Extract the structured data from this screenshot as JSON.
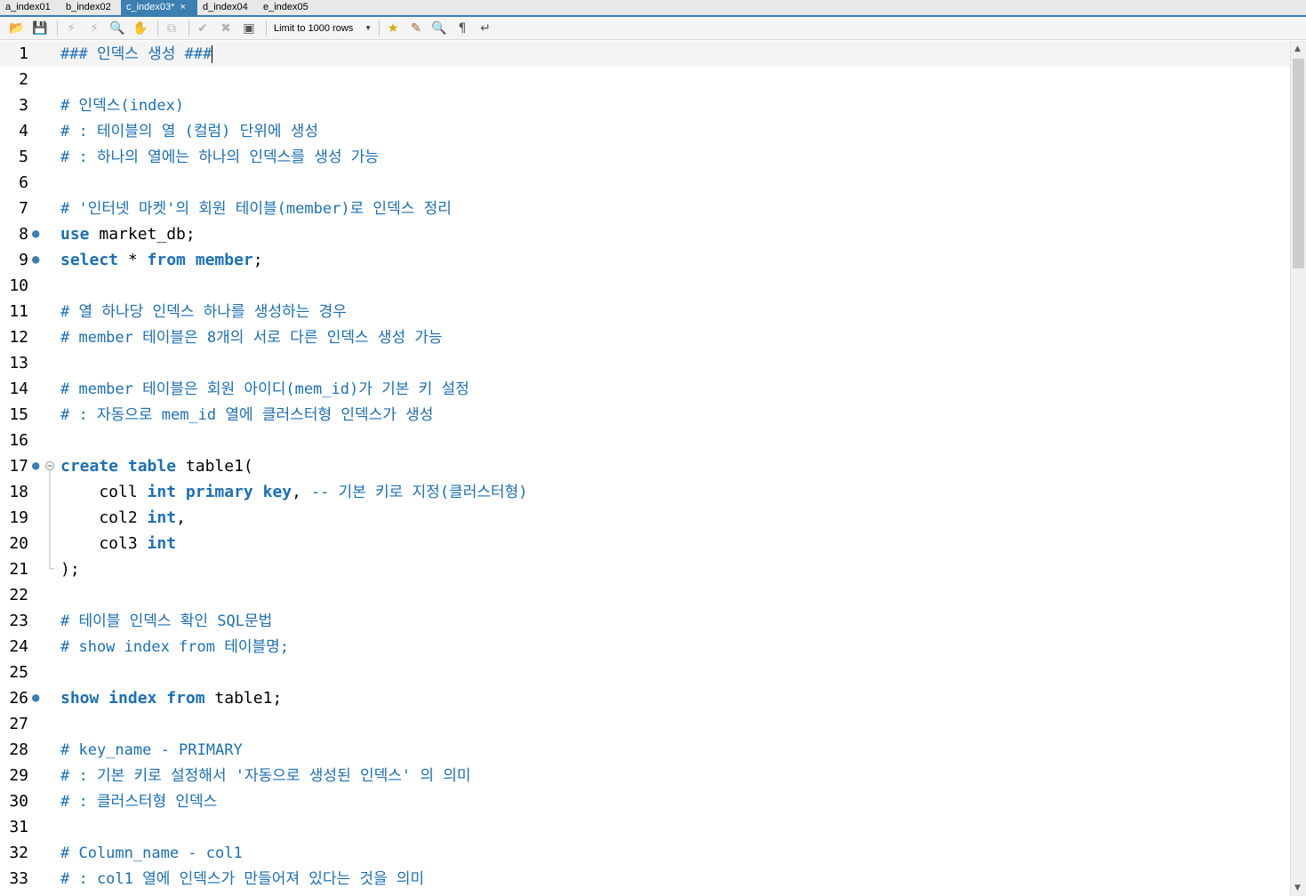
{
  "tabs": [
    {
      "label": "a_index01",
      "active": false
    },
    {
      "label": "b_index02",
      "active": false
    },
    {
      "label": "c_index03*",
      "active": true
    },
    {
      "label": "d_index04",
      "active": false
    },
    {
      "label": "e_index05",
      "active": false
    }
  ],
  "toolbar": {
    "limit_label": "Limit to 1000 rows",
    "icons": [
      "open-folder-icon",
      "save-icon",
      "execute-icon",
      "execute-current-icon",
      "explain-icon",
      "stop-icon",
      "toggle-continue-icon",
      "commit-icon",
      "rollback-icon",
      "autocommit-icon",
      "favorite-icon",
      "beautify-icon",
      "find-icon",
      "invisible-chars-icon",
      "wrap-icon"
    ]
  },
  "editor": {
    "lines": [
      {
        "n": "1",
        "tokens": [
          {
            "t": "### 인덱스 생성 ###",
            "c": "cm"
          }
        ],
        "current": true,
        "cursor": true
      },
      {
        "n": "2",
        "tokens": []
      },
      {
        "n": "3",
        "tokens": [
          {
            "t": "# 인덱스(index)",
            "c": "cm"
          }
        ]
      },
      {
        "n": "4",
        "tokens": [
          {
            "t": "# : 테이블의 열 (컬럼) 단위에 생성",
            "c": "cm"
          }
        ]
      },
      {
        "n": "5",
        "tokens": [
          {
            "t": "# : 하나의 열에는 하나의 인덱스를 생성 가능",
            "c": "cm"
          }
        ]
      },
      {
        "n": "6",
        "tokens": []
      },
      {
        "n": "7",
        "tokens": [
          {
            "t": "# '인터넷 마켓'의 회원 테이블(member)로 인덱스 정리",
            "c": "cm"
          }
        ]
      },
      {
        "n": "8",
        "marker": true,
        "tokens": [
          {
            "t": "use",
            "c": "kw"
          },
          {
            "t": " market_db;",
            "c": "id"
          }
        ]
      },
      {
        "n": "9",
        "marker": true,
        "tokens": [
          {
            "t": "select",
            "c": "kw"
          },
          {
            "t": " * ",
            "c": "id"
          },
          {
            "t": "from",
            "c": "kw"
          },
          {
            "t": " ",
            "c": "id"
          },
          {
            "t": "member",
            "c": "kw"
          },
          {
            "t": ";",
            "c": "id"
          }
        ]
      },
      {
        "n": "10",
        "tokens": []
      },
      {
        "n": "11",
        "tokens": [
          {
            "t": "# 열 하나당 인덱스 하나를 생성하는 경우",
            "c": "cm"
          }
        ]
      },
      {
        "n": "12",
        "tokens": [
          {
            "t": "# member 테이블은 8개의 서로 다른 인덱스 생성 가능",
            "c": "cm"
          }
        ]
      },
      {
        "n": "13",
        "tokens": []
      },
      {
        "n": "14",
        "tokens": [
          {
            "t": "# member 테이블은 회원 아이디(mem_id)가 기본 키 설정",
            "c": "cm"
          }
        ]
      },
      {
        "n": "15",
        "tokens": [
          {
            "t": "# : 자동으로 mem_id 열에 클러스터형 인덱스가 생성",
            "c": "cm"
          }
        ]
      },
      {
        "n": "16",
        "tokens": []
      },
      {
        "n": "17",
        "marker": true,
        "fold": "start",
        "tokens": [
          {
            "t": "create",
            "c": "kw"
          },
          {
            "t": " ",
            "c": "id"
          },
          {
            "t": "table",
            "c": "kw"
          },
          {
            "t": " table1(",
            "c": "id"
          }
        ]
      },
      {
        "n": "18",
        "fold": "mid",
        "tokens": [
          {
            "t": "    coll ",
            "c": "id"
          },
          {
            "t": "int",
            "c": "kw"
          },
          {
            "t": " ",
            "c": "id"
          },
          {
            "t": "primary key",
            "c": "kw"
          },
          {
            "t": ", ",
            "c": "id"
          },
          {
            "t": "-- 기본 키로 지정(클러스터형)",
            "c": "cm"
          }
        ]
      },
      {
        "n": "19",
        "fold": "mid",
        "tokens": [
          {
            "t": "    col2 ",
            "c": "id"
          },
          {
            "t": "int",
            "c": "kw"
          },
          {
            "t": ",",
            "c": "id"
          }
        ]
      },
      {
        "n": "20",
        "fold": "mid",
        "tokens": [
          {
            "t": "    col3 ",
            "c": "id"
          },
          {
            "t": "int",
            "c": "kw"
          }
        ]
      },
      {
        "n": "21",
        "fold": "end",
        "tokens": [
          {
            "t": ");",
            "c": "id"
          }
        ]
      },
      {
        "n": "22",
        "tokens": []
      },
      {
        "n": "23",
        "tokens": [
          {
            "t": "# 테이블 인덱스 확인 SQL문법",
            "c": "cm"
          }
        ]
      },
      {
        "n": "24",
        "tokens": [
          {
            "t": "# show index from 테이블명;",
            "c": "cm"
          }
        ]
      },
      {
        "n": "25",
        "tokens": []
      },
      {
        "n": "26",
        "marker": true,
        "tokens": [
          {
            "t": "show index from",
            "c": "kw"
          },
          {
            "t": " table1;",
            "c": "id"
          }
        ]
      },
      {
        "n": "27",
        "tokens": []
      },
      {
        "n": "28",
        "tokens": [
          {
            "t": "# key_name - PRIMARY",
            "c": "cm"
          }
        ]
      },
      {
        "n": "29",
        "tokens": [
          {
            "t": "# : 기본 키로 설정해서 '자동으로 생성된 인덱스' 의 의미",
            "c": "cm"
          }
        ]
      },
      {
        "n": "30",
        "tokens": [
          {
            "t": "# : 클러스터형 인덱스",
            "c": "cm"
          }
        ]
      },
      {
        "n": "31",
        "tokens": []
      },
      {
        "n": "32",
        "tokens": [
          {
            "t": "# Column_name - col1",
            "c": "cm"
          }
        ]
      },
      {
        "n": "33",
        "tokens": [
          {
            "t": "# : col1 열에 인덱스가 만들어져 있다는 것을 의미",
            "c": "cm"
          }
        ]
      }
    ]
  },
  "scrollbar": {
    "position_fraction": 0.0
  }
}
